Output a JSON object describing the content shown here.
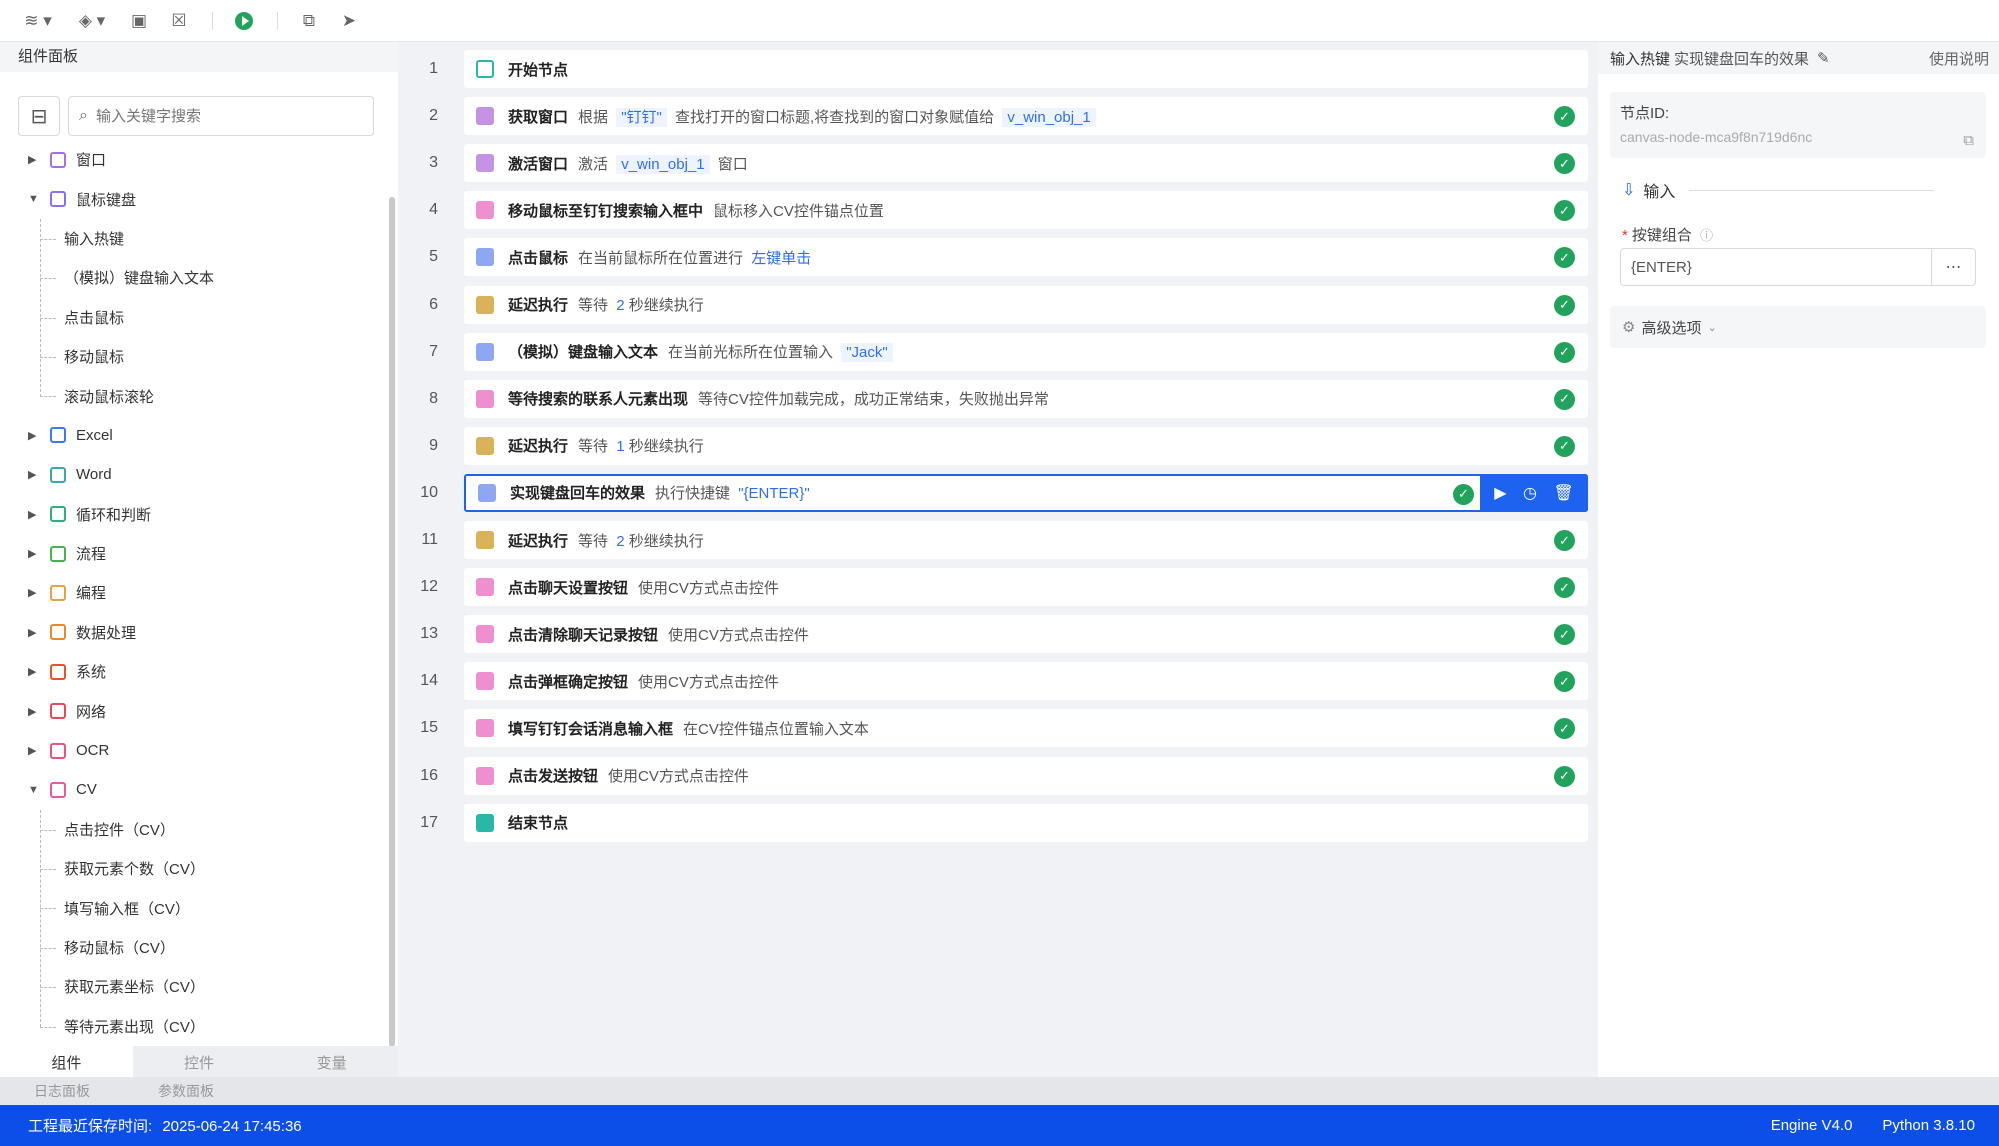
{
  "toolbar": {
    "buttons": [
      "layers-dropdown",
      "stack-dropdown",
      "save",
      "close",
      "run",
      "copy",
      "send"
    ]
  },
  "left_panel": {
    "title": "组件面板",
    "search_placeholder": "输入关键字搜索",
    "tree": [
      {
        "label": "窗口",
        "expanded": false,
        "icon": "window-icon",
        "color": "#a96ee0"
      },
      {
        "label": "鼠标键盘",
        "expanded": true,
        "icon": "mouse-keyboard-icon",
        "color": "#8a6ff0",
        "children": [
          "输入热键",
          "（模拟）键盘输入文本",
          "点击鼠标",
          "移动鼠标",
          "滚动鼠标滚轮"
        ]
      },
      {
        "label": "Excel",
        "expanded": false,
        "icon": "excel-icon",
        "color": "#3a7bf0"
      },
      {
        "label": "Word",
        "expanded": false,
        "icon": "word-icon",
        "color": "#3aa8b0"
      },
      {
        "label": "循环和判断",
        "expanded": false,
        "icon": "loop-icon",
        "color": "#2fb07a"
      },
      {
        "label": "流程",
        "expanded": false,
        "icon": "flow-icon",
        "color": "#4cb050"
      },
      {
        "label": "编程",
        "expanded": false,
        "icon": "code-icon",
        "color": "#e6a23c"
      },
      {
        "label": "数据处理",
        "expanded": false,
        "icon": "data-icon",
        "color": "#e8892a"
      },
      {
        "label": "系统",
        "expanded": false,
        "icon": "system-icon",
        "color": "#e8542a"
      },
      {
        "label": "网络",
        "expanded": false,
        "icon": "wifi-icon",
        "color": "#e84a5a"
      },
      {
        "label": "OCR",
        "expanded": false,
        "icon": "eye-icon",
        "color": "#e8547a"
      },
      {
        "label": "CV",
        "expanded": true,
        "icon": "image-icon",
        "color": "#e85aa0",
        "children": [
          "点击控件（CV）",
          "获取元素个数（CV）",
          "填写输入框（CV）",
          "移动鼠标（CV）",
          "获取元素坐标（CV）",
          "等待元素出现（CV）"
        ]
      }
    ],
    "tabs": [
      "组件",
      "控件",
      "变量"
    ],
    "active_tab": "组件"
  },
  "bottom_tabs": [
    "日志面板",
    "参数面板"
  ],
  "flow": [
    {
      "n": "1",
      "icon": "teal",
      "title": "开始节点",
      "parts": []
    },
    {
      "n": "2",
      "icon": "purple",
      "title": "获取窗口",
      "parts": [
        [
          "t",
          "根据 "
        ],
        [
          "tag",
          "\"钉钉\""
        ],
        [
          "t",
          " 查找打开的窗口标题,将查找到的窗口对象赋值给 "
        ],
        [
          "tag",
          "v_win_obj_1"
        ]
      ],
      "ok": true
    },
    {
      "n": "3",
      "icon": "purple",
      "title": "激活窗口",
      "parts": [
        [
          "t",
          "激活 "
        ],
        [
          "tag",
          "v_win_obj_1"
        ],
        [
          "t",
          " 窗口"
        ]
      ],
      "ok": true
    },
    {
      "n": "4",
      "icon": "pink",
      "title": "移动鼠标至钉钉搜索输入框中",
      "parts": [
        [
          "t",
          "鼠标移入CV控件锚点位置"
        ]
      ],
      "ok": true
    },
    {
      "n": "5",
      "icon": "blue",
      "title": "点击鼠标",
      "parts": [
        [
          "t",
          "在当前鼠标所在位置进行 "
        ],
        [
          "link",
          "左键单击"
        ]
      ],
      "ok": true
    },
    {
      "n": "6",
      "icon": "gold",
      "title": "延迟执行",
      "parts": [
        [
          "t",
          "等待 "
        ],
        [
          "link",
          "2"
        ],
        [
          "t",
          " 秒继续执行"
        ]
      ],
      "ok": true
    },
    {
      "n": "7",
      "icon": "blue",
      "title": "（模拟）键盘输入文本",
      "parts": [
        [
          "t",
          "在当前光标所在位置输入 "
        ],
        [
          "tag",
          "\"Jack\""
        ]
      ],
      "ok": true
    },
    {
      "n": "8",
      "icon": "pink",
      "title": "等待搜索的联系人元素出现",
      "parts": [
        [
          "t",
          "等待CV控件加载完成，成功正常结束，失败抛出异常"
        ]
      ],
      "ok": true
    },
    {
      "n": "9",
      "icon": "gold",
      "title": "延迟执行",
      "parts": [
        [
          "t",
          "等待 "
        ],
        [
          "link",
          "1"
        ],
        [
          "t",
          " 秒继续执行"
        ]
      ],
      "ok": true
    },
    {
      "n": "10",
      "icon": "blue",
      "title": "实现键盘回车的效果",
      "parts": [
        [
          "t",
          "执行快捷键 "
        ],
        [
          "link",
          "\"{ENTER}\""
        ]
      ],
      "ok": true,
      "selected": true
    },
    {
      "n": "11",
      "icon": "gold",
      "title": "延迟执行",
      "parts": [
        [
          "t",
          "等待 "
        ],
        [
          "link",
          "2"
        ],
        [
          "t",
          " 秒继续执行"
        ]
      ],
      "ok": true
    },
    {
      "n": "12",
      "icon": "pink",
      "title": "点击聊天设置按钮",
      "parts": [
        [
          "t",
          "使用CV方式点击控件"
        ]
      ],
      "ok": true
    },
    {
      "n": "13",
      "icon": "pink",
      "title": "点击清除聊天记录按钮",
      "parts": [
        [
          "t",
          "使用CV方式点击控件"
        ]
      ],
      "ok": true
    },
    {
      "n": "14",
      "icon": "pink",
      "title": "点击弹框确定按钮",
      "parts": [
        [
          "t",
          "使用CV方式点击控件"
        ]
      ],
      "ok": true
    },
    {
      "n": "15",
      "icon": "pink",
      "title": "填写钉钉会话消息输入框",
      "parts": [
        [
          "t",
          "在CV控件锚点位置输入文本"
        ]
      ],
      "ok": true
    },
    {
      "n": "16",
      "icon": "pink",
      "title": "点击发送按钮",
      "parts": [
        [
          "t",
          "使用CV方式点击控件"
        ]
      ],
      "ok": true
    },
    {
      "n": "17",
      "icon": "teal-f",
      "title": "结束节点",
      "parts": []
    }
  ],
  "right_panel": {
    "component": "输入热键",
    "node_name": "实现键盘回车的效果",
    "help": "使用说明",
    "node_id_label": "节点ID:",
    "node_id": "canvas-node-mca9f8n719d6nc",
    "section": "输入",
    "field_label": "按键组合",
    "field_value": "{ENTER}",
    "advanced": "高级选项"
  },
  "status": {
    "saved_label": "工程最近保存时间:",
    "saved_time": "2025-06-24 17:45:36",
    "engine": "Engine V4.0",
    "python": "Python 3.8.10"
  }
}
